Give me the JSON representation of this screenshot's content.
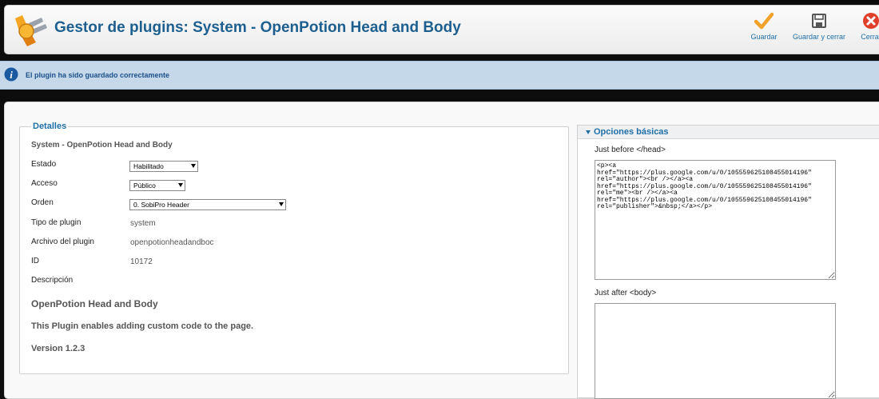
{
  "header": {
    "title": "Gestor de plugins: System - OpenPotion Head and Body",
    "toolbar": {
      "save": {
        "label": "Guardar",
        "icon": "checkmark-icon"
      },
      "save_close": {
        "label": "Guardar y cerrar",
        "icon": "save-disk-icon"
      },
      "close": {
        "label": "Cerrar",
        "icon": "close-icon"
      }
    }
  },
  "message": {
    "icon": "info-icon",
    "text": "El plugin ha sido guardado correctamente"
  },
  "details": {
    "legend": "Detalles",
    "subtitle": "System - OpenPotion Head and Body",
    "fields": {
      "estado": {
        "label": "Estado",
        "value": "Habilitado"
      },
      "acceso": {
        "label": "Acceso",
        "value": "Público"
      },
      "orden": {
        "label": "Orden",
        "value": "0. SobiPro Header"
      },
      "tipo": {
        "label": "Tipo de plugin",
        "value": "system"
      },
      "archivo": {
        "label": "Archivo del plugin",
        "value": "openpotionheadandboc"
      },
      "id": {
        "label": "ID",
        "value": "10172"
      },
      "descripcion": {
        "label": "Descripción"
      }
    },
    "plugin_name": "OpenPotion Head and Body",
    "plugin_description": "This Plugin enables adding custom code to the page.",
    "plugin_version": "Version 1.2.3"
  },
  "options": {
    "title": "Opciones básicas",
    "before_head": {
      "label": "Just before </head>",
      "value": "<p><a href=\"https://plus.google.com/u/0/105559625108455014196\" rel=\"author\"><br /></a><a href=\"https://plus.google.com/u/0/105559625108455014196\" rel=\"me\"><br /></a><a href=\"https://plus.google.com/u/0/105559625108455014196\" rel=\"publisher\">&nbsp;</a></p>"
    },
    "after_body": {
      "label": "Just after <body>",
      "value": ""
    }
  },
  "colors": {
    "title": "#1d5f8e",
    "accent": "#1f6fa8",
    "message_bg": "#c4d8ea",
    "save": "#f0a22b",
    "close": "#e0402a"
  }
}
